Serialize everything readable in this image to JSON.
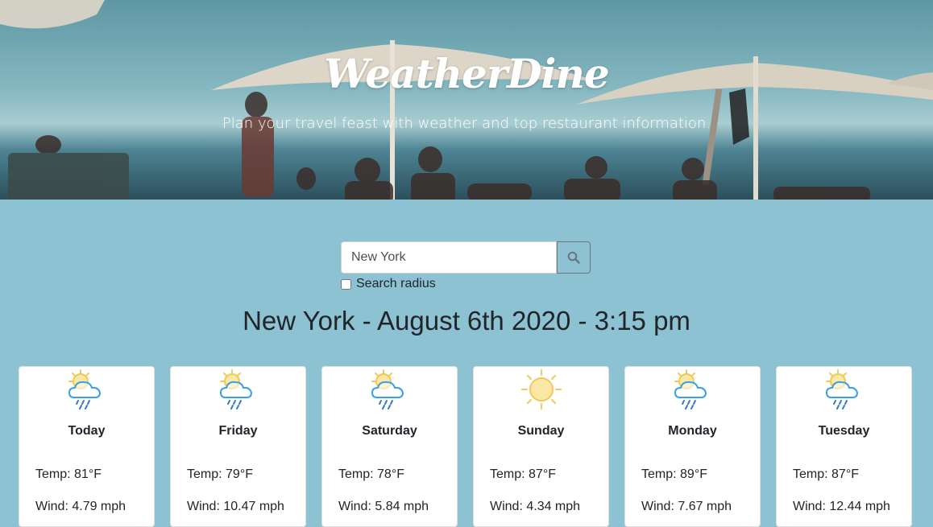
{
  "hero": {
    "title": "WeatherDine",
    "subtitle": "Plan your travel feast with weather and top restaurant information."
  },
  "search": {
    "value": "New York",
    "button_icon": "search-icon",
    "radius_label": "Search radius",
    "radius_checked": false
  },
  "heading": "New York - August 6th 2020 - 3:15 pm",
  "forecast": [
    {
      "day": "Today",
      "icon": "partly-cloudy-rain-icon",
      "temp": "Temp: 81°F",
      "wind": "Wind: 4.79 mph"
    },
    {
      "day": "Friday",
      "icon": "partly-cloudy-rain-icon",
      "temp": "Temp: 79°F",
      "wind": "Wind: 10.47 mph"
    },
    {
      "day": "Saturday",
      "icon": "partly-cloudy-rain-icon",
      "temp": "Temp: 78°F",
      "wind": "Wind: 5.84 mph"
    },
    {
      "day": "Sunday",
      "icon": "sun-icon",
      "temp": "Temp: 87°F",
      "wind": "Wind: 4.34 mph"
    },
    {
      "day": "Monday",
      "icon": "partly-cloudy-rain-icon",
      "temp": "Temp: 89°F",
      "wind": "Wind: 7.67 mph"
    },
    {
      "day": "Tuesday",
      "icon": "partly-cloudy-rain-icon",
      "temp": "Temp: 87°F",
      "wind": "Wind: 12.44 mph"
    }
  ],
  "colors": {
    "page_background": "#8dc2d3",
    "card_background": "#ffffff",
    "sun": "#fce8a6",
    "cloud_outline": "#3aa0e8",
    "rain": "#3a78c8"
  }
}
